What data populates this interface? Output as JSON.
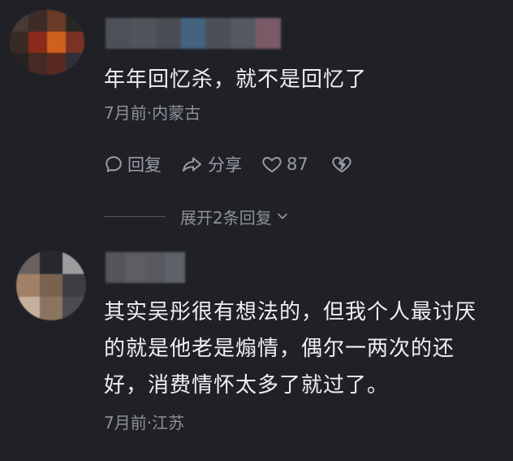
{
  "comments": [
    {
      "text": "年年回忆杀，就不是回忆了",
      "meta": "7月前·内蒙古",
      "actions": {
        "reply_label": "回复",
        "share_label": "分享",
        "like_count": "87"
      },
      "expand_label": "展开2条回复",
      "avatar_pixels": [
        "#4a3a34",
        "#3c2b27",
        "#6a3a26",
        "#2a2624",
        "#3a2a26",
        "#8a2a1a",
        "#d0601e",
        "#7a3222",
        "#262324",
        "#442a22",
        "#5a2a22",
        "#303036"
      ],
      "username_pixels": [
        "#4e5057",
        "#52545b",
        "#4b4d54",
        "#43647f",
        "#4d4f58",
        "#565860",
        "#7a5a66"
      ]
    },
    {
      "text": "其实吴彤很有想法的，但我个人最讨厌的就是他老是煽情，偶尔一两次的还好，消费情怀太多了就过了。",
      "meta": "7月前·江苏",
      "avatar_pixels": [
        "#6a6160",
        "#26282c",
        "#9a9c9e",
        "#a08066",
        "#7a6250",
        "#3b3d42",
        "#c4b09c",
        "#8a7460",
        "#4a4c52"
      ],
      "username_pixels": [
        "#54565c",
        "#5c5e64",
        "#585a60",
        "#60626a"
      ]
    }
  ],
  "colors": {
    "background": "#202127",
    "text": "#eef0f4",
    "meta": "#8e9099",
    "icon": "#9a9ca6"
  }
}
